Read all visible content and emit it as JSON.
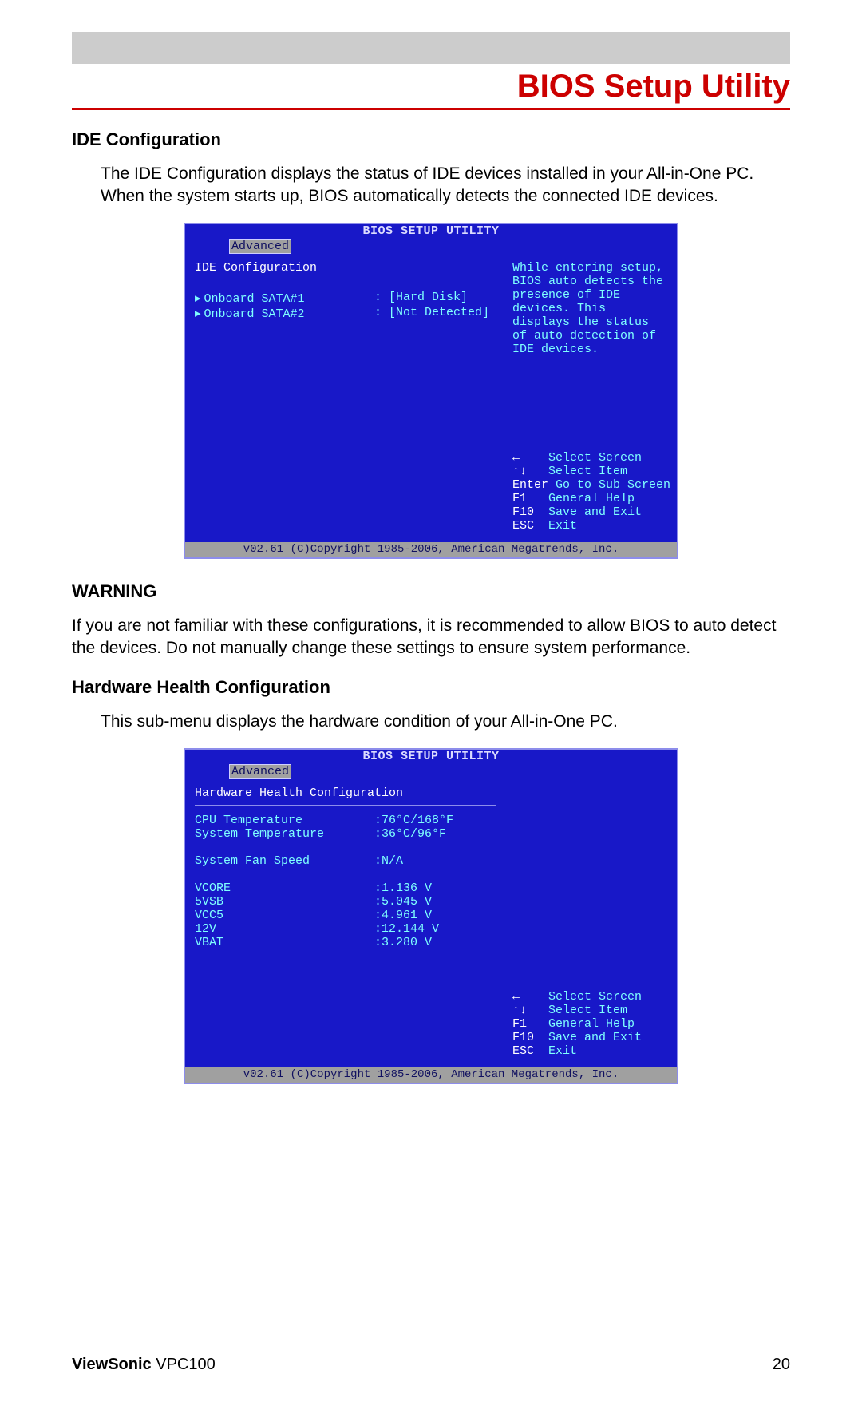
{
  "header": {
    "title": "BIOS Setup Utility"
  },
  "ide": {
    "heading": "IDE Configuration",
    "description": "The IDE Configuration displays the status of IDE devices installed in your All-in-One PC. When the system starts up, BIOS automatically detects the connected IDE devices."
  },
  "warning": {
    "heading": "WARNING",
    "text": "If you are not familiar with these configurations, it is recommended to allow BIOS to auto detect the devices. Do not manually change these settings to ensure system performance."
  },
  "hardware": {
    "heading": "Hardware Health Configuration",
    "description": "This sub-menu displays the hardware condition of your All-in-One PC."
  },
  "bios_common": {
    "title": "BIOS SETUP UTILITY",
    "tab": "Advanced",
    "footer": "v02.61 (C)Copyright 1985-2006, American Megatrends, Inc."
  },
  "bios1": {
    "section": "IDE Configuration",
    "rows": [
      {
        "label": "Onboard SATA#1",
        "value": "[Hard Disk]"
      },
      {
        "label": "Onboard SATA#2",
        "value": "[Not Detected]"
      }
    ],
    "help_top": "While entering setup, BIOS auto detects the presence of IDE devices. This displays the status of auto detection of IDE devices.",
    "help_keys": [
      {
        "k": "←",
        "t": "Select Screen"
      },
      {
        "k": "↑↓",
        "t": "Select Item"
      },
      {
        "k": "Enter",
        "t": "Go to Sub Screen"
      },
      {
        "k": "F1",
        "t": "General Help"
      },
      {
        "k": "F10",
        "t": "Save and Exit"
      },
      {
        "k": "ESC",
        "t": "Exit"
      }
    ]
  },
  "bios2": {
    "section": "Hardware Health Configuration",
    "rows": [
      {
        "label": "CPU Temperature",
        "value": ":76°C/168°F"
      },
      {
        "label": "System Temperature",
        "value": ":36°C/96°F"
      },
      {
        "label": "",
        "value": ""
      },
      {
        "label": "System Fan Speed",
        "value": ":N/A"
      },
      {
        "label": "",
        "value": ""
      },
      {
        "label": "VCORE",
        "value": ":1.136 V"
      },
      {
        "label": "5VSB",
        "value": ":5.045 V"
      },
      {
        "label": "VCC5",
        "value": ":4.961 V"
      },
      {
        "label": "12V",
        "value": ":12.144 V"
      },
      {
        "label": "VBAT",
        "value": ":3.280 V"
      }
    ],
    "help_keys": [
      {
        "k": "←",
        "t": "Select Screen"
      },
      {
        "k": "↑↓",
        "t": "Select Item"
      },
      {
        "k": "F1",
        "t": "General Help"
      },
      {
        "k": "F10",
        "t": "Save and Exit"
      },
      {
        "k": "ESC",
        "t": "Exit"
      }
    ]
  },
  "footer": {
    "brand": "ViewSonic",
    "model": "VPC100",
    "page": "20"
  }
}
